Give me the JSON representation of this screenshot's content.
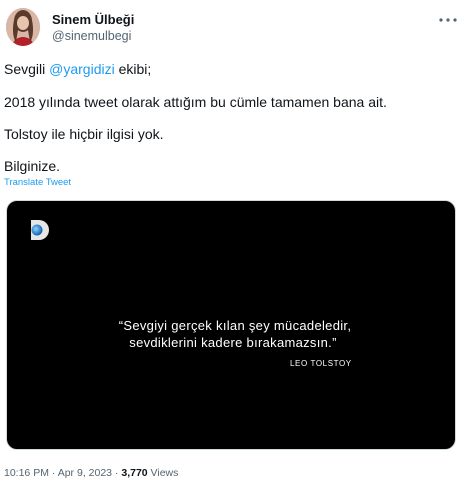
{
  "user": {
    "name": "Sinem Ülbeği",
    "handle": "@sinemulbegi"
  },
  "tweet": {
    "line1_prefix": "Sevgili ",
    "mention": "@yargidizi",
    "line1_suffix": " ekibi;",
    "line2": "2018 yılında tweet olarak attığım bu cümle tamamen bana ait.",
    "line3": "Tolstoy ile hiçbir ilgisi yok.",
    "line4": "Bilginize.",
    "translate_label": "Translate Tweet"
  },
  "media": {
    "quote_line1": "“Sevgiyi gerçek kılan şey mücadeledir,",
    "quote_line2": "sevdiklerini kadere bırakamazsın.”",
    "author": "LEO TOLSTOY",
    "logo_icon": "kanal-d-logo-icon"
  },
  "meta": {
    "time": "10:16 PM",
    "sep1": " · ",
    "date": "Apr 9, 2023",
    "sep2": " · ",
    "views_count": "3,770",
    "views_label": " Views"
  },
  "colors": {
    "accent": "#1d9bf0",
    "text": "#0f1419",
    "muted": "#536471"
  }
}
